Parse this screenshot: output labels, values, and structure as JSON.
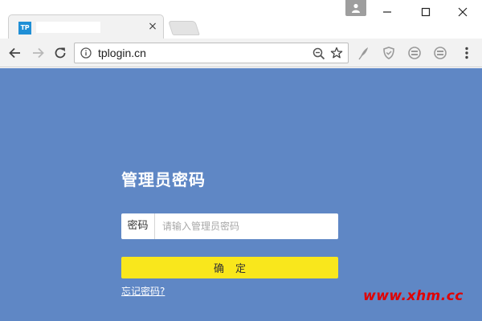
{
  "browser": {
    "tab": {
      "favicon_text": "TP",
      "title": "",
      "close_label": "×"
    },
    "address_bar": {
      "url": "tplogin.cn"
    }
  },
  "page": {
    "background_color": "#5f87c5",
    "login": {
      "title": "管理员密码",
      "password_label": "密码",
      "password_placeholder": "请输入管理员密码",
      "password_value": "",
      "confirm_label": "确定",
      "forgot_link": "忘记密码?"
    },
    "watermark": "www.xhm.cc"
  },
  "colors": {
    "confirm_button": "#f9e71c",
    "watermark": "#e00000",
    "favicon": "#1f8fd6"
  }
}
